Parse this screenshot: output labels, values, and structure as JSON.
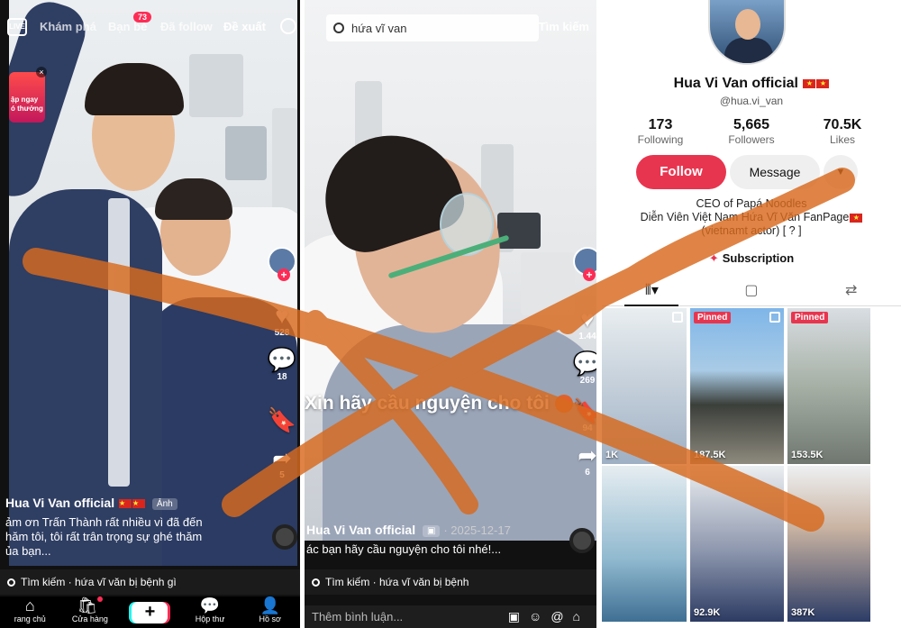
{
  "panel1": {
    "nav": {
      "live": "LIVE",
      "tabs": [
        "Khám phá",
        "Bạn bè",
        "Đã follow",
        "Đề xuất"
      ],
      "friends_badge": "73"
    },
    "promo": {
      "text": "ập ngay\nó thưởng",
      "close": "×"
    },
    "sidebar": {
      "like_count": "528",
      "comment_count": "18",
      "save_count": "",
      "share_count": "5"
    },
    "author": "Hua Vi Van official",
    "photo_pill": "Ảnh",
    "description": "ảm ơn Trấn Thành rất nhiều vì đã đến\nhăm tôi, tôi rất trân trọng sự ghé thăm\nủa bạn...",
    "search_bar": "Tìm kiếm · hứa vĩ văn bị bệnh gì",
    "bottom_nav": [
      {
        "label": "rang chủ",
        "icon": "home-icon"
      },
      {
        "label": "Cửa hàng",
        "icon": "shop-icon"
      },
      {
        "label": "",
        "icon": "create-icon"
      },
      {
        "label": "Hộp thư",
        "icon": "inbox-icon"
      },
      {
        "label": "Hồ sơ",
        "icon": "profile-icon"
      }
    ]
  },
  "panel2": {
    "search_value": "hứa vĩ van",
    "search_button": "Tìm kiếm",
    "overlay_text": "Xin hãy cầu nguyện cho tôi",
    "sidebar": {
      "like_count": "1.44",
      "comment_count": "269",
      "save_count": "94",
      "share_count": "6"
    },
    "author": "Hua Vi Van official",
    "date": "· 2025-12-17",
    "description": "ác bạn hãy cầu nguyện cho tôi nhé!...",
    "search_bar": "Tìm kiếm · hứa vĩ văn bị bệnh",
    "comment_placeholder": "Thêm bình luận..."
  },
  "panel3": {
    "name": "Hua Vi Van official",
    "handle": "@hua.vi_van",
    "stats": [
      {
        "num": "173",
        "label": "Following"
      },
      {
        "num": "5,665",
        "label": "Followers"
      },
      {
        "num": "70.5K",
        "label": "Likes"
      }
    ],
    "follow_label": "Follow",
    "message_label": "Message",
    "more_label": "▼",
    "bio": [
      "CEO of Papá Noodles",
      "Diễn Viên Việt Nam Hứa Vĩ Văn FanPage",
      "(vietnamt actor)  [ ? ]"
    ],
    "subscription": "Subscription",
    "thumbs": [
      {
        "pinned": "",
        "views": "1K"
      },
      {
        "pinned": "Pinned",
        "views": "187.5K"
      },
      {
        "pinned": "Pinned",
        "views": "153.5K"
      },
      {
        "pinned": "",
        "views": ""
      },
      {
        "pinned": "",
        "views": "92.9K"
      },
      {
        "pinned": "",
        "views": "387K"
      }
    ]
  },
  "colors": {
    "accent": "#fe2c55",
    "follow": "#e8354f",
    "stroke": "#d86a1e"
  }
}
